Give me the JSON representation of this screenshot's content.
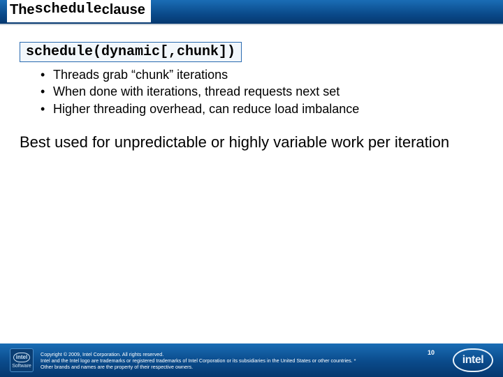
{
  "title": {
    "pre": "The ",
    "mono1": "schedule",
    "mid": " clause"
  },
  "syntax": "schedule(dynamic[,chunk])",
  "bullets": [
    "Threads grab “chunk” iterations",
    "When done with iterations, thread requests next set",
    "Higher threading overhead, can reduce load imbalance"
  ],
  "summary": "Best used for unpredictable or highly variable work per iteration",
  "footer": {
    "badge_label": "intel",
    "badge_sub": "Software",
    "copyright": "Copyright © 2009, Intel Corporation. All rights reserved.",
    "trademark": "Intel and the Intel logo are trademarks or registered trademarks of Intel Corporation or its subsidiaries in the United States or other countries. * Other brands and names are the property of their respective owners.",
    "page": "10",
    "logo_text": "intel"
  }
}
